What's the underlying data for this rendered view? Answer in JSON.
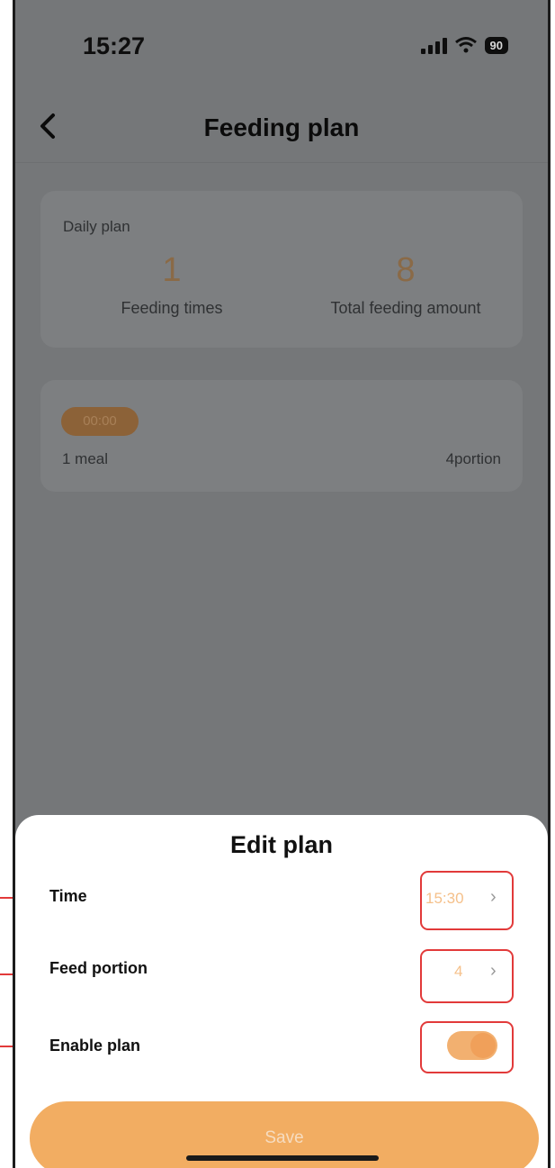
{
  "status": {
    "time": "15:27",
    "battery": "90"
  },
  "header": {
    "title": "Feeding plan"
  },
  "daily_plan": {
    "label": "Daily plan",
    "feeding_times": {
      "value": "1",
      "label": "Feeding times"
    },
    "total_amount": {
      "value": "8",
      "label": "Total feeding amount"
    }
  },
  "meal": {
    "time": "00:00",
    "name": "1 meal",
    "portion": "4portion"
  },
  "edit_sheet": {
    "title": "Edit plan",
    "time_label": "Time",
    "time_value": "15:30",
    "portion_label": "Feed portion",
    "portion_value": "4",
    "enable_label": "Enable plan",
    "enable_on": true,
    "save_label": "Save"
  },
  "colors": {
    "accent": "#f2ad62",
    "highlight": "#e23a3a"
  }
}
